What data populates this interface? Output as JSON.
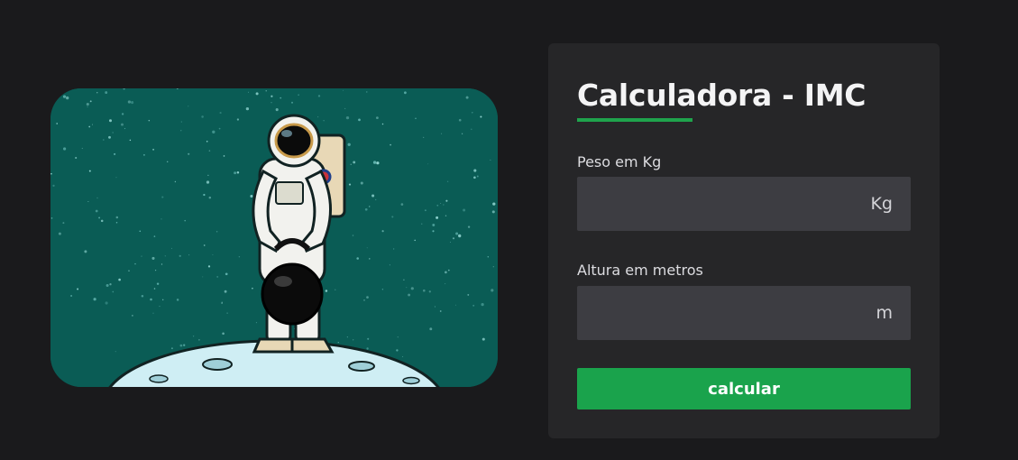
{
  "illustration": {
    "alt": "astronaut holding a kettlebell on the moon",
    "background_color": "#0a5c55"
  },
  "card": {
    "title": "Calculadora - IMC",
    "accent_color": "#1fa34c",
    "weight": {
      "label": "Peso em Kg",
      "value": "",
      "unit": "Kg"
    },
    "height": {
      "label": "Altura em metros",
      "value": "",
      "unit": "m"
    },
    "button_label": "calcular"
  }
}
